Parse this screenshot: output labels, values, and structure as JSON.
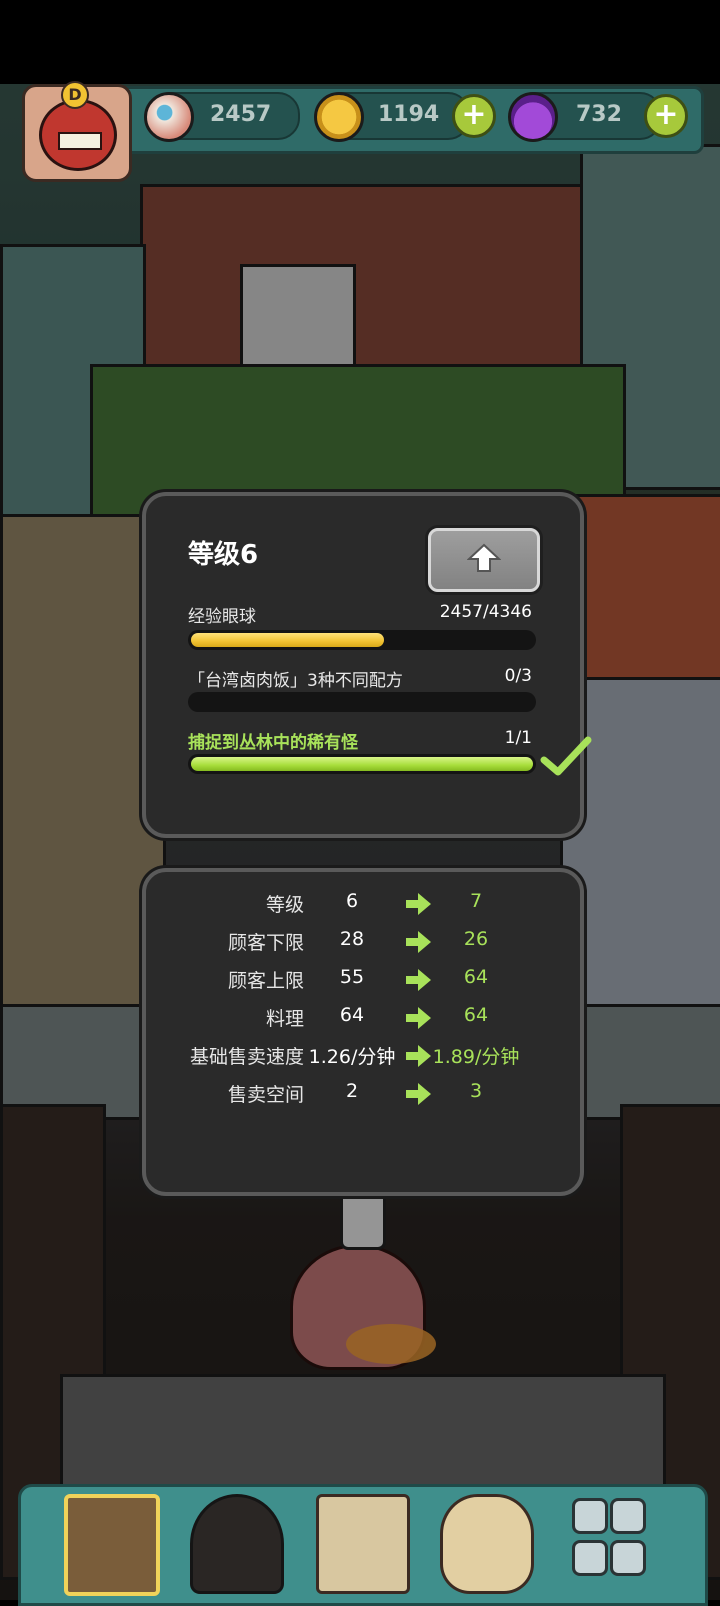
{
  "resources": {
    "eyeball_count": "2457",
    "coin_count": "1194",
    "potion_count": "732",
    "avatar_badge": "D"
  },
  "level_panel": {
    "title": "等级6",
    "requirements": [
      {
        "label": "经验眼球",
        "value": "2457/4346",
        "progress": 0.565,
        "color": "yellow",
        "completed": false
      },
      {
        "label": "「台湾卤肉饭」3种不同配方",
        "value": "0/3",
        "progress": 0.0,
        "color": "green",
        "completed": false
      },
      {
        "label": "捕捉到丛林中的稀有怪",
        "value": "1/1",
        "progress": 1.0,
        "color": "green",
        "completed": true
      }
    ]
  },
  "stats_panel": {
    "rows": [
      {
        "name": "等级",
        "current": "6",
        "next": "7"
      },
      {
        "name": "顾客下限",
        "current": "28",
        "next": "26"
      },
      {
        "name": "顾客上限",
        "current": "55",
        "next": "64"
      },
      {
        "name": "料理",
        "current": "64",
        "next": "64"
      },
      {
        "name": "基础售卖速度",
        "current": "1.26/分钟",
        "next": "1.89/分钟"
      },
      {
        "name": "售卖空间",
        "current": "2",
        "next": "3"
      }
    ]
  },
  "colors": {
    "accent_green": "#a8e25a",
    "exp_yellow": "#f1c232",
    "panel_bg": "#2a2a2a"
  },
  "bottom_nav": [
    "shop-icon",
    "monster-icon",
    "recipe-book-icon",
    "money-bag-icon",
    "monster-grid-icon"
  ]
}
